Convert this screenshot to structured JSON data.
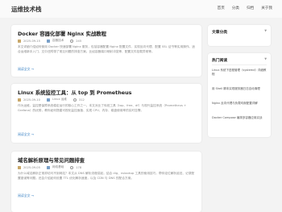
{
  "header": {
    "site_title": "运维技术栈",
    "nav": [
      "首页",
      "分类",
      "归档",
      "关于我"
    ]
  },
  "posts": [
    {
      "title": "Docker 容器化部署 Nginx 实战教程",
      "date": "2025-09-15",
      "category": "容器技术",
      "views": "245",
      "excerpt": "本文详细介绍如何使用 Docker 快速部署 Nginx 服务，包括容器配置 Nginx 配置文件、实现反向代理、配置 SSL 证书等实用操作。适合运维新手入门，文中还附带了常见问题的排查方案。比如容器端口映射冲突等、配置文件挂载异常等。",
      "readmore": "阅读全文 →"
    },
    {
      "title": "Linux 系统监控工具：从 top 到 Prometheus",
      "date": "2025-09-10",
      "category": "Linux 运维",
      "views": "312",
      "excerpt": "作为运维，监控是保障系统稳定运行的核心工作之一。本文对比了传统工具（top、free、df）与现代监控系统（Prometheus + Grafana）的优势，教你如何搭建可视化监控面板、实现 CPU、内存、磁盘使用率的实时告警。",
      "readmore": "阅读全文 →"
    },
    {
      "title": "域名解析原理与常见问题排查",
      "date": "2025-09-05",
      "category": "网络基础",
      "views": "178",
      "excerpt": "为什么域名解析正常却访问不到网站？本文从 DNS 解析流程讲起，结合 dig、nslookup 工具的使用技巧，帮你定位解析延迟、记录配置错误等问题。还会介绍如何设置 TTL 优化解析速度，以及 CDN 与 DNS 的配合方案。",
      "readmore": "阅读全文 →"
    }
  ],
  "sidebar": {
    "categories_title": "文章分类",
    "hot_title": "热门阅读",
    "hot_posts": [
      "Linux 系统下进程管理（systemd）详细教程",
      "用 Shell 脚本实现服务器日志自动清理",
      "Nginx 反向代理与负载均衡配置详解",
      "Docker Compose 编排多容器应用实战"
    ],
    "chevron": "▼"
  }
}
